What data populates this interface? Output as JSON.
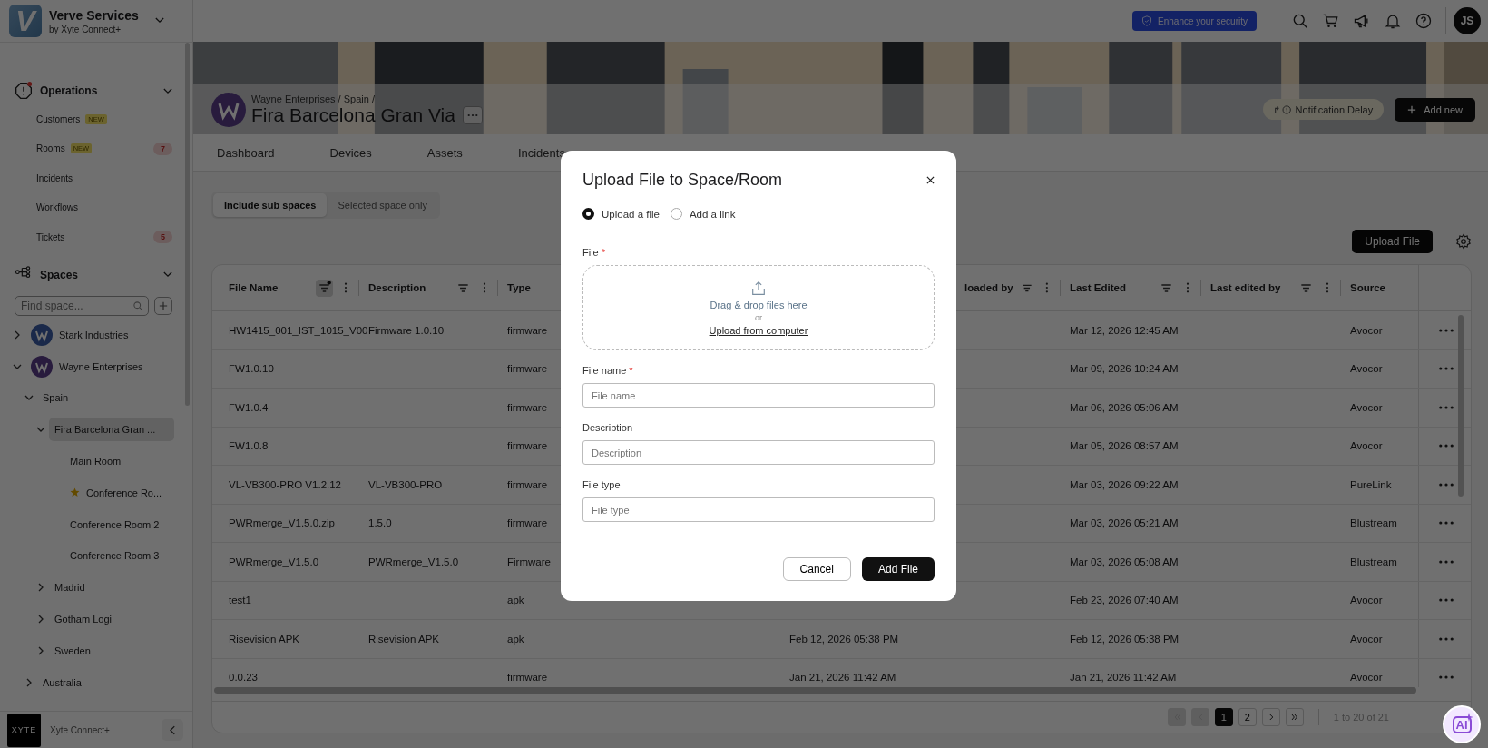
{
  "app": {
    "logo_letter": "V",
    "name": "Verve Services",
    "subtitle": "by Xyte Connect+"
  },
  "topbar": {
    "security_badge": "Enhance your security",
    "avatar": "JS"
  },
  "sidebar": {
    "operations": {
      "title": "Operations",
      "alert": true,
      "expanded": true,
      "items": [
        {
          "label": "Customers",
          "badge": "NEW"
        },
        {
          "label": "Rooms",
          "badge": "NEW",
          "count": "7"
        },
        {
          "label": "Incidents"
        },
        {
          "label": "Workflows"
        },
        {
          "label": "Tickets",
          "count": "5"
        }
      ]
    },
    "spaces": {
      "title": "Spaces",
      "expanded": true,
      "search_placeholder": "Find space...",
      "tree": [
        {
          "label": "Stark Industries",
          "kind": "org",
          "expanded": false,
          "selected": false
        },
        {
          "label": "Wayne Enterprises",
          "kind": "org",
          "expanded": true,
          "selected": false,
          "children": [
            {
              "label": "Spain",
              "kind": "place",
              "expanded": true,
              "selected": false,
              "children": [
                {
                  "label": "Fira Barcelona Gran ...",
                  "kind": "place",
                  "expanded": true,
                  "selected": true,
                  "children": [
                    {
                      "label": "Main Room",
                      "kind": "room",
                      "starred": false,
                      "selected": false
                    },
                    {
                      "label": "Conference Ro...",
                      "kind": "room",
                      "starred": true,
                      "selected": false
                    },
                    {
                      "label": "Conference Room 2",
                      "kind": "room",
                      "starred": false,
                      "selected": false
                    },
                    {
                      "label": "Conference Room 3",
                      "kind": "room",
                      "starred": false,
                      "selected": false
                    }
                  ]
                },
                {
                  "label": "Madrid",
                  "kind": "place",
                  "expanded": false,
                  "selected": false
                },
                {
                  "label": "Gotham Logi",
                  "kind": "place",
                  "expanded": false,
                  "selected": false
                },
                {
                  "label": "Sweden",
                  "kind": "place",
                  "expanded": false,
                  "selected": false
                }
              ]
            },
            {
              "label": "Australia",
              "kind": "place",
              "expanded": false,
              "selected": false
            }
          ]
        }
      ]
    },
    "footer": {
      "logo": "XYTE",
      "label": "Xyte Connect+"
    }
  },
  "page": {
    "breadcrumb": "Wayne Enterprises / Spain /",
    "title": "Fira Barcelona Gran Via",
    "notification": "Notification Delay",
    "add_button": "Add new",
    "tabs": [
      {
        "label": "Dashboard",
        "selected": false
      },
      {
        "label": "Devices",
        "selected": false
      },
      {
        "label": "Assets",
        "selected": false
      },
      {
        "label": "Incidents",
        "selected": false
      }
    ]
  },
  "scope": [
    {
      "label": "Include sub spaces",
      "selected": true
    },
    {
      "label": "Selected space only",
      "selected": false
    }
  ],
  "upload_button": "Upload File",
  "table": {
    "headers": {
      "file_name": {
        "label": "File Name",
        "filter_active": true
      },
      "description": {
        "label": "Description",
        "filter_active": false
      },
      "type": {
        "label": "Type"
      },
      "uploaded_by": {
        "label": "loaded by",
        "filter_active": false
      },
      "last_edited": {
        "label": "Last Edited",
        "filter_active": false
      },
      "last_edited_by": {
        "label": "Last edited by",
        "filter_active": false
      },
      "source": {
        "label": "Source"
      }
    },
    "rows": [
      {
        "file_name": "HW1415_001_IST_1015_V00",
        "description": "Firmware 1.0.10",
        "type": "firmware",
        "last_edited": "Mar 12, 2026 12:45 AM",
        "source": "Avocor"
      },
      {
        "file_name": "FW1.0.10",
        "type": "firmware",
        "last_edited": "Mar 09, 2026 10:24 AM",
        "source": "Avocor"
      },
      {
        "file_name": "FW1.0.4",
        "type": "firmware",
        "last_edited": "Mar 06, 2026 05:06 AM",
        "source": "Avocor"
      },
      {
        "file_name": "FW1.0.8",
        "type": "firmware",
        "last_edited": "Mar 05, 2026 08:57 AM",
        "source": "Avocor"
      },
      {
        "file_name": "VL-VB300-PRO V1.2.12",
        "description": "VL-VB300-PRO",
        "type": "firmware",
        "last_edited": "Mar 03, 2026 09:22 AM",
        "source": "PureLink"
      },
      {
        "file_name": "PWRmerge_V1.5.0.zip",
        "description": "1.5.0",
        "type": "firmware",
        "last_edited": "Mar 03, 2026 05:21 AM",
        "source": "Blustream"
      },
      {
        "file_name": "PWRmerge_V1.5.0",
        "description": "PWRmerge_V1.5.0",
        "type": "Firmware",
        "last_edited": "Mar 03, 2026 05:08 AM",
        "source": "Blustream"
      },
      {
        "file_name": "test1",
        "type": "apk",
        "last_edited": "Feb 23, 2026 07:40 AM",
        "source": "Avocor"
      },
      {
        "file_name": "Risevision APK",
        "description": "Risevision APK",
        "type": "apk",
        "column_4": "Feb 12, 2026 05:38 PM",
        "last_edited": "Feb 12, 2026 05:38 PM",
        "source": "Avocor"
      },
      {
        "file_name": "0.0.23",
        "type": "firmware",
        "column_4": "Jan 21, 2026 11:42 AM",
        "last_edited": "Jan 21, 2026 11:42 AM",
        "source": "Avocor"
      }
    ]
  },
  "pagination": {
    "nav": [
      {
        "kind": "first",
        "disabled": true
      },
      {
        "kind": "prev",
        "disabled": true
      },
      {
        "kind": "next",
        "disabled": false
      },
      {
        "kind": "last",
        "disabled": false
      }
    ],
    "pages": [
      {
        "label": "1",
        "selected": true
      },
      {
        "label": "2",
        "selected": false
      }
    ],
    "summary": "1 to 20 of 21"
  },
  "ai_button": "AI",
  "modal": {
    "title": "Upload File to Space/Room",
    "options": [
      {
        "label": "Upload a file",
        "selected": true
      },
      {
        "label": "Add a link",
        "selected": false
      }
    ],
    "file_label": "File",
    "file_required_mark": "*",
    "drop_text": "Drag & drop files here",
    "or_text": "or",
    "upload_link": "Upload from computer",
    "fields": [
      {
        "label": "File name",
        "required_mark": "*",
        "placeholder": "File name"
      },
      {
        "label": "Description",
        "placeholder": "Description"
      },
      {
        "label": "File type",
        "placeholder": "File type"
      }
    ],
    "cancel": "Cancel",
    "submit": "Add File"
  }
}
